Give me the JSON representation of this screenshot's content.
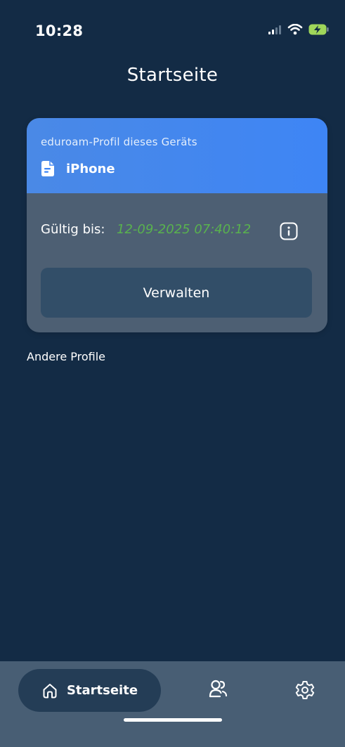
{
  "status_bar": {
    "time": "10:28"
  },
  "header": {
    "title": "Startseite"
  },
  "current_profile": {
    "subtitle": "eduroam-Profil dieses Geräts",
    "device_name": "iPhone",
    "device_icon": "document-icon",
    "validity_label": "Gültig bis:",
    "validity_date": "12-09-2025 07:40:12",
    "manage_label": "Verwalten",
    "colors": {
      "header": "#3e85f5",
      "validity_date": "#59b24e",
      "card_background": "#4d5f73",
      "button_background": "#324e68"
    }
  },
  "other_profiles": {
    "label": "Andere Profile"
  },
  "tab_bar": {
    "items": [
      {
        "label": "Startseite",
        "icon": "home-icon",
        "active": true
      },
      {
        "label": "",
        "icon": "profiles-icon",
        "active": false
      },
      {
        "label": "",
        "icon": "settings-icon",
        "active": false
      }
    ]
  },
  "colors": {
    "background": "#132b45",
    "tab_bar": "#485e74",
    "active_tab": "#243d56"
  }
}
